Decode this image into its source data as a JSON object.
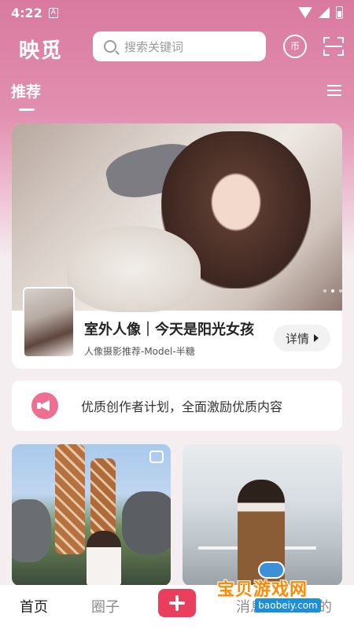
{
  "status_bar": {
    "time": "4:22",
    "notification_glyph": "A"
  },
  "header": {
    "logo": "映觅",
    "search_placeholder": "搜索关键词",
    "coin_label": "币"
  },
  "tabs": {
    "active": "推荐"
  },
  "banner": {
    "title": "室外人像｜今天是阳光女孩",
    "subtitle": "人像摄影推荐-Model-半糖",
    "detail_button": "详情"
  },
  "notice": {
    "text": "优质创作者计划，全面激励优质内容"
  },
  "bottom_nav": {
    "home": "首页",
    "circle": "圈子",
    "messages": "消息",
    "mine": "我的"
  },
  "watermark": {
    "name": "宝贝游戏网",
    "url": "baobeiy.com"
  },
  "colors": {
    "accent": "#ea3f5c",
    "header_pink": "#d9799f",
    "notice_icon": "#ee6f91"
  }
}
